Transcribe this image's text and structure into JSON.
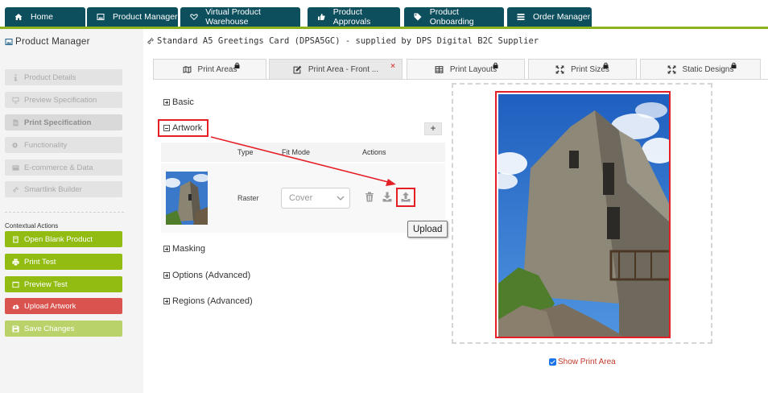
{
  "top_nav": {
    "tabs": [
      {
        "label": "Home",
        "icon": "home-icon"
      },
      {
        "label": "Product Manager",
        "icon": "image-icon"
      },
      {
        "label": "Virtual Product Warehouse",
        "icon": "heart-icon"
      },
      {
        "label": "Product Approvals",
        "icon": "thumbs-up-icon"
      },
      {
        "label": "Product Onboarding",
        "icon": "tag-icon"
      },
      {
        "label": "Order Manager",
        "icon": "list-icon"
      }
    ],
    "accent_color": "#8cb31e",
    "tab_color": "#0e4f5e"
  },
  "sidebar": {
    "title": "Product Manager",
    "items": [
      {
        "label": "Product Details",
        "icon": "info-icon"
      },
      {
        "label": "Preview Specification",
        "icon": "monitor-icon"
      },
      {
        "label": "Print Specification",
        "icon": "document-icon",
        "active": true
      },
      {
        "label": "Functionality",
        "icon": "gears-icon"
      },
      {
        "label": "E-commerce & Data",
        "icon": "card-icon"
      },
      {
        "label": "Smartlink Builder",
        "icon": "link-icon"
      }
    ],
    "contextual_title": "Contextual Actions",
    "actions": [
      {
        "label": "Open Blank Product",
        "icon": "file-icon",
        "color": "#92bc12"
      },
      {
        "label": "Print Test",
        "icon": "printer-icon",
        "color": "#92bc12"
      },
      {
        "label": "Preview Test",
        "icon": "eye-icon",
        "color": "#92bc12"
      },
      {
        "label": "Upload Artwork",
        "icon": "cloud-upload-icon",
        "color": "#d9534f"
      },
      {
        "label": "Save Changes",
        "icon": "save-icon",
        "color": "#b9d26a"
      }
    ]
  },
  "product_header": "Standard A5 Greetings Card (DPSA5GC) - supplied by DPS Digital B2C Supplier",
  "print_tabs": [
    {
      "label": "Print Areas",
      "icon": "map-icon",
      "locked": true
    },
    {
      "label": "Print Area - Front ...",
      "icon": "edit-icon",
      "closable": true,
      "close_glyph": "×"
    },
    {
      "label": "Print Layouts",
      "icon": "grid-icon",
      "locked": true
    },
    {
      "label": "Print Sizes",
      "icon": "expand-icon",
      "locked": true
    },
    {
      "label": "Static Designs",
      "icon": "expand-icon",
      "locked": true
    }
  ],
  "sections": {
    "basic": "Basic",
    "artwork": "Artwork",
    "masking": "Masking",
    "options": "Options (Advanced)",
    "regions": "Regions (Advanced)",
    "add_glyph": "+"
  },
  "artwork_table": {
    "columns": [
      "Type",
      "Fit Mode",
      "Actions"
    ],
    "rows": [
      {
        "type": "Raster",
        "fit_mode": "Cover"
      }
    ]
  },
  "tooltip": "Upload",
  "preview": {
    "show_print_area_label": "Show Print Area",
    "show_print_area_checked": true
  }
}
